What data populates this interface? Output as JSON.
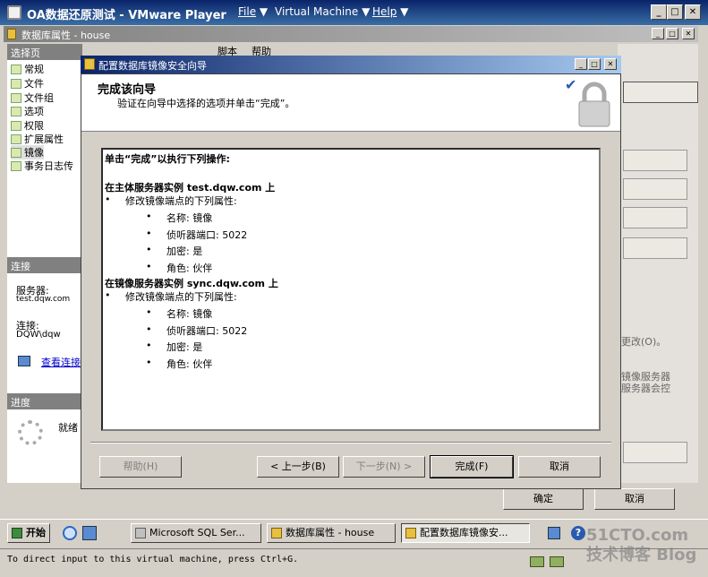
{
  "vm": {
    "title": "OA数据还原测试 - VMware Player",
    "menu_file": "File",
    "menu_vm": "Virtual Machine",
    "menu_help": "Help"
  },
  "db_dialog": {
    "title": "数据库属性 - house",
    "toolbar_script": "脚本",
    "toolbar_help": "帮助",
    "select_page_header": "选择页",
    "pages": [
      "常规",
      "文件",
      "文件组",
      "选项",
      "权限",
      "扩展属性",
      "镜像",
      "事务日志传"
    ],
    "connection_header": "连接",
    "server_label": "服务器:",
    "server_value": "test.dqw.com",
    "conn_label": "连接:",
    "conn_value": "DQW\\dqw",
    "view_conn": "查看连接",
    "progress_header": "进度",
    "progress_status": "就绪",
    "ghost_text_1": "更改(O)。",
    "ghost_text_2": "镜像服务器",
    "ghost_text_3": "服务器会控",
    "ok": "确定",
    "cancel": "取消"
  },
  "wizard": {
    "title": "配置数据库镜像安全向导",
    "heading": "完成该向导",
    "subheading": "验证在向导中选择的选项并单击“完成”。",
    "intro": "单击“完成”以执行下列操作:",
    "principal_header": "在主体服务器实例 test.dqw.com 上",
    "principal_modify": "修改镜像端点的下列属性:",
    "principal_props": [
      "名称: 镜像",
      "侦听器端口: 5022",
      "加密: 是",
      "角色: 伙伴"
    ],
    "mirror_header": "在镜像服务器实例 sync.dqw.com 上",
    "mirror_modify": "修改镜像端点的下列属性:",
    "mirror_props": [
      "名称: 镜像",
      "侦听器端口: 5022",
      "加密: 是",
      "角色: 伙伴"
    ],
    "btn_help": "帮助(H)",
    "btn_back": "< 上一步(B)",
    "btn_next": "下一步(N) >",
    "btn_finish": "完成(F)",
    "btn_cancel": "取消"
  },
  "taskbar": {
    "start": "开始",
    "tasks": [
      "Microsoft SQL Ser...",
      "数据库属性 - house",
      "配置数据库镜像安..."
    ]
  },
  "status_text": "To direct input to this virtual machine, press Ctrl+G.",
  "watermark": "51CTO.com 技术博客 Blog"
}
